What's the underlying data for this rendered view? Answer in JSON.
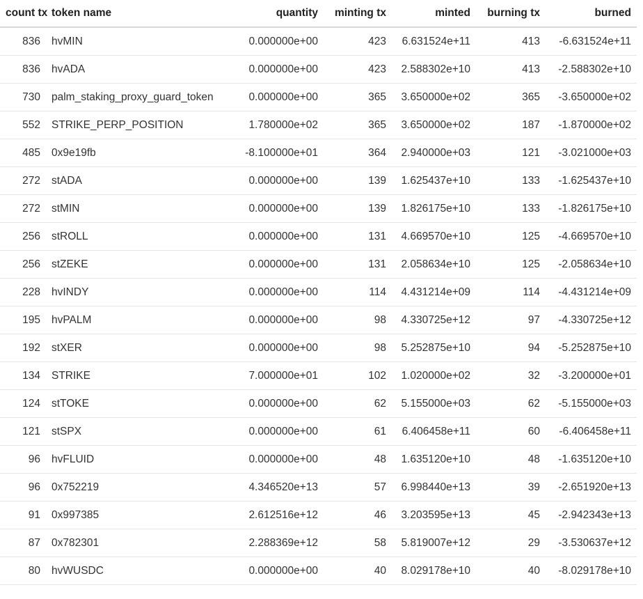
{
  "table": {
    "headers": {
      "count_tx": "count tx",
      "token_name": "token name",
      "quantity": "quantity",
      "minting_tx": "minting tx",
      "minted": "minted",
      "burning_tx": "burning tx",
      "burned": "burned"
    },
    "rows": [
      [
        "836",
        "hvMIN",
        "0.000000e+00",
        "423",
        "6.631524e+11",
        "413",
        "-6.631524e+11"
      ],
      [
        "836",
        "hvADA",
        "0.000000e+00",
        "423",
        "2.588302e+10",
        "413",
        "-2.588302e+10"
      ],
      [
        "730",
        "palm_staking_proxy_guard_token",
        "0.000000e+00",
        "365",
        "3.650000e+02",
        "365",
        "-3.650000e+02"
      ],
      [
        "552",
        "STRIKE_PERP_POSITION",
        "1.780000e+02",
        "365",
        "3.650000e+02",
        "187",
        "-1.870000e+02"
      ],
      [
        "485",
        "0x9e19fb",
        "-8.100000e+01",
        "364",
        "2.940000e+03",
        "121",
        "-3.021000e+03"
      ],
      [
        "272",
        "stADA",
        "0.000000e+00",
        "139",
        "1.625437e+10",
        "133",
        "-1.625437e+10"
      ],
      [
        "272",
        "stMIN",
        "0.000000e+00",
        "139",
        "1.826175e+10",
        "133",
        "-1.826175e+10"
      ],
      [
        "256",
        "stROLL",
        "0.000000e+00",
        "131",
        "4.669570e+10",
        "125",
        "-4.669570e+10"
      ],
      [
        "256",
        "stZEKE",
        "0.000000e+00",
        "131",
        "2.058634e+10",
        "125",
        "-2.058634e+10"
      ],
      [
        "228",
        "hvINDY",
        "0.000000e+00",
        "114",
        "4.431214e+09",
        "114",
        "-4.431214e+09"
      ],
      [
        "195",
        "hvPALM",
        "0.000000e+00",
        "98",
        "4.330725e+12",
        "97",
        "-4.330725e+12"
      ],
      [
        "192",
        "stXER",
        "0.000000e+00",
        "98",
        "5.252875e+10",
        "94",
        "-5.252875e+10"
      ],
      [
        "134",
        "STRIKE",
        "7.000000e+01",
        "102",
        "1.020000e+02",
        "32",
        "-3.200000e+01"
      ],
      [
        "124",
        "stTOKE",
        "0.000000e+00",
        "62",
        "5.155000e+03",
        "62",
        "-5.155000e+03"
      ],
      [
        "121",
        "stSPX",
        "0.000000e+00",
        "61",
        "6.406458e+11",
        "60",
        "-6.406458e+11"
      ],
      [
        "96",
        "hvFLUID",
        "0.000000e+00",
        "48",
        "1.635120e+10",
        "48",
        "-1.635120e+10"
      ],
      [
        "96",
        "0x752219",
        "4.346520e+13",
        "57",
        "6.998440e+13",
        "39",
        "-2.651920e+13"
      ],
      [
        "91",
        "0x997385",
        "2.612516e+12",
        "46",
        "3.203595e+13",
        "45",
        "-2.942343e+13"
      ],
      [
        "87",
        "0x782301",
        "2.288369e+12",
        "58",
        "5.819007e+12",
        "29",
        "-3.530637e+12"
      ],
      [
        "80",
        "hvWUSDC",
        "0.000000e+00",
        "40",
        "8.029178e+10",
        "40",
        "-8.029178e+10"
      ]
    ]
  }
}
